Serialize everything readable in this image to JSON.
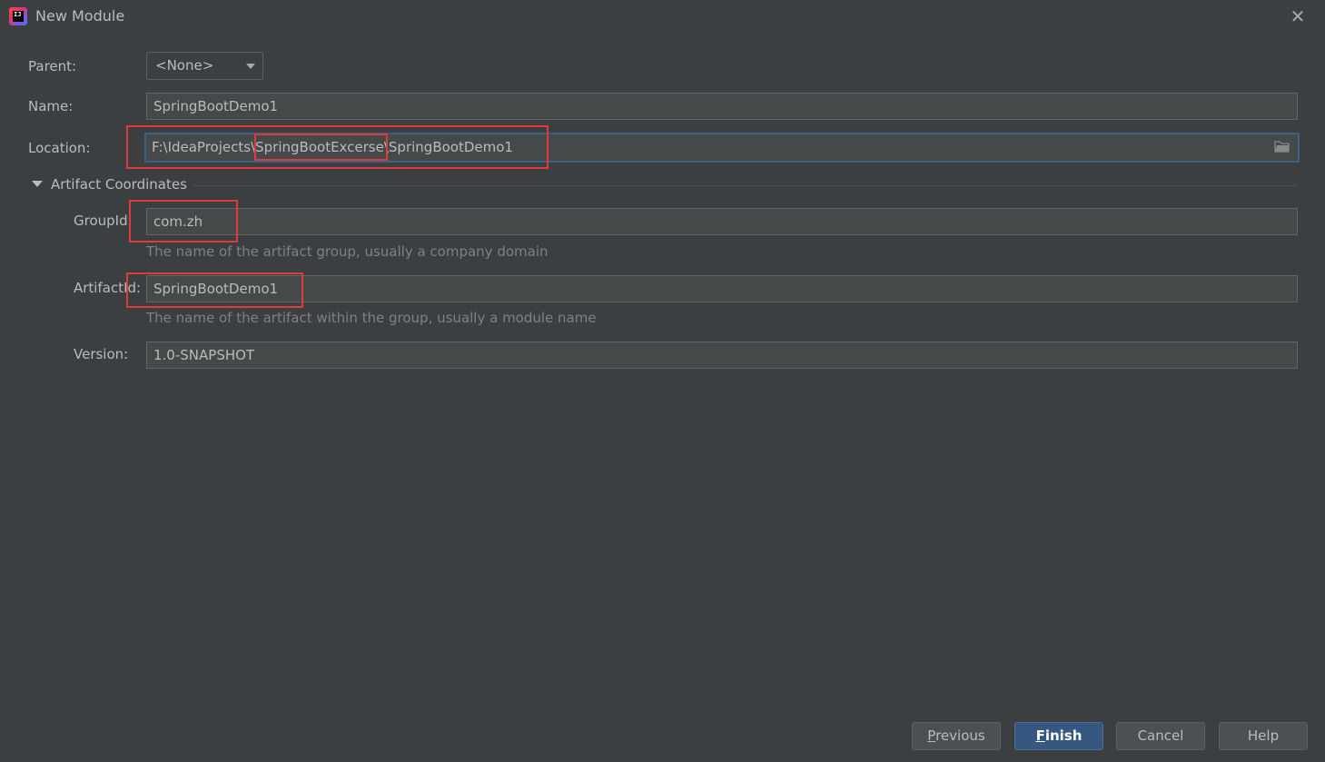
{
  "window": {
    "title": "New Module",
    "close_symbol": "✕"
  },
  "form": {
    "parent": {
      "label": "Parent:",
      "value": "<None>"
    },
    "name": {
      "label": "Name:",
      "value": "SpringBootDemo1"
    },
    "location": {
      "label": "Location:",
      "prefix": "F:\\IdeaProjects\\",
      "highlight": "SpringBootExcerse",
      "suffix": "\\SpringBootDemo1"
    }
  },
  "artifact": {
    "section_title": "Artifact Coordinates",
    "group_id": {
      "label": "GroupId",
      "value": "com.zh",
      "hint": "The name of the artifact group, usually a company domain"
    },
    "artifact_id": {
      "label": "ArtifactId:",
      "value": "SpringBootDemo1",
      "hint": "The name of the artifact within the group, usually a module name"
    },
    "version": {
      "label": "Version:",
      "value": "1.0-SNAPSHOT"
    }
  },
  "buttons": {
    "previous": {
      "mnemonic": "P",
      "rest": "revious"
    },
    "finish": {
      "mnemonic": "F",
      "rest": "inish"
    },
    "cancel": "Cancel",
    "help": "Help"
  },
  "colors": {
    "background": "#3c3f41",
    "field": "#45494a",
    "focus_border": "#3d6185",
    "default_button": "#365880",
    "annotation_red": "#e03b3b"
  },
  "icons": [
    "app-icon",
    "close-icon",
    "chevron-down-icon",
    "triangle-down-icon",
    "folder-icon"
  ]
}
